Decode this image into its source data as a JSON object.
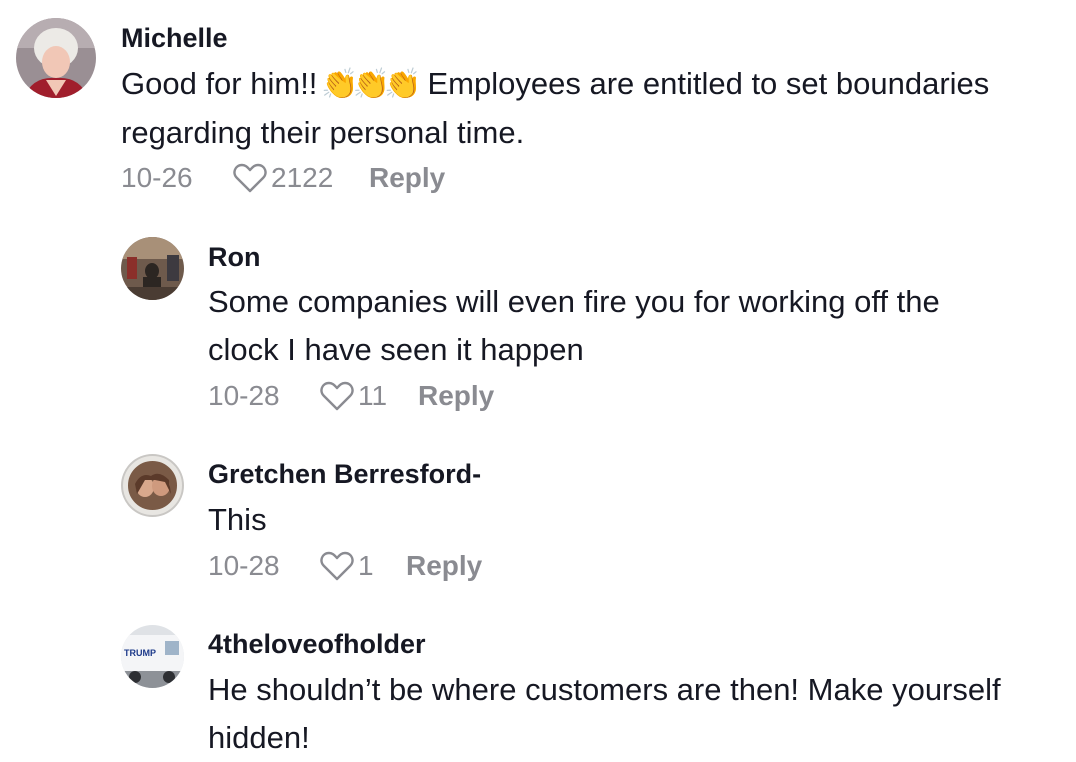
{
  "comments": [
    {
      "username": "Michelle",
      "text_before": "Good for him!!",
      "emoji": "👏👏👏",
      "emoji_icon": "clapping-hands-icon",
      "text_after_line1": "Employees are entitled to set boundaries",
      "text_line2": "regarding their personal time.",
      "date": "10-26",
      "likes": "2122",
      "reply_label": "Reply"
    },
    {
      "username": "Ron",
      "text_line1": "Some companies will even fire you for working off the",
      "text_line2": "clock I have seen it happen",
      "date": "10-28",
      "likes": "11",
      "reply_label": "Reply"
    },
    {
      "username": "Gretchen Berresford-",
      "text_line1": "This",
      "date": "10-28",
      "likes": "1",
      "reply_label": "Reply"
    },
    {
      "username": "4theloveofholder",
      "avatar_text": "TRUMP",
      "text_line1": "He shouldn’t be where customers are then! Make yourself",
      "text_line2": "hidden!"
    }
  ],
  "colors": {
    "primary_text": "#161823",
    "secondary_text": "#8a8b91"
  }
}
